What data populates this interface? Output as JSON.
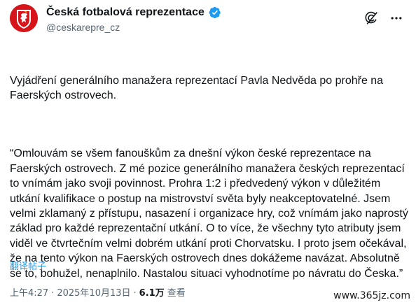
{
  "author": {
    "display_name": "Česká fotbalová reprezentace",
    "handle": "@ceskarepre_cz",
    "verified": true,
    "avatar_icon": "czech-lion-crest-icon",
    "avatar_color": "#d7141a"
  },
  "header_actions": [
    {
      "name": "grok-icon"
    },
    {
      "name": "more-options-icon"
    }
  ],
  "tweet": {
    "paragraph_1": "Vyjádření generálního manažera reprezentací Pavla Nedvěda po prohře na Faerských ostrovech.",
    "paragraph_2": "“Omlouvám se všem fanouškům za dnešní výkon české reprezentace na Faerských ostrovech. Z mé pozice generálního manažera českých reprezentací to vnímám jako svoji povinnost. Prohra 1:2 i předvedený výkon v důležitém utkání kvalifikace o postup na mistrovství světa byly neakceptovatelné. Jsem velmi zklamaný z přístupu, nasazení i organizace hry, což vnímám jako naprostý základ pro každé reprezentační utkání. O to více, že všechny tyto atributy jsem viděl ve čtvrtečním velmi dobrém utkání proti Chorvatsku. I proto jsem očekával, že na tento výkon na Faerských ostrovech dnes dokážeme navázat. Absolutně se to, bohužel, nenaplnilo. Nastalou situaci vyhodnotíme po návratu do Česka.”",
    "translate_label": "翻译帖子"
  },
  "meta": {
    "time": "上午4:27",
    "separator": "·",
    "date": "2025年10月13日",
    "views_count": "6.1万",
    "views_label": "查看"
  },
  "watermark": "www.365jz.com",
  "colors": {
    "text": "#0f1419",
    "secondary": "#536471",
    "link": "#1d9bf0",
    "verified": "#1d9bf0"
  }
}
